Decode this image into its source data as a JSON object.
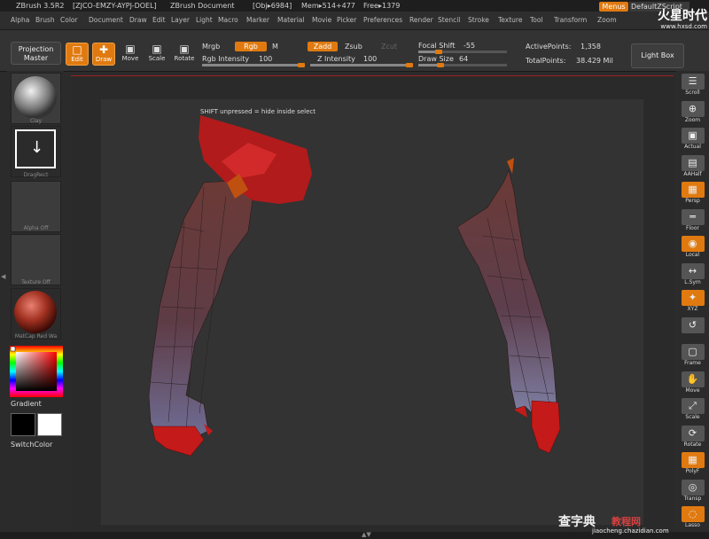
{
  "title_bar": {
    "app": "ZBrush 3.5R2",
    "license": "[ZJCO-EMZY-AYPJ-DOEL]",
    "document": "ZBrush Document",
    "obj": "[Obj▸6984]",
    "mem": "Mem▸514+477",
    "free": "Free▸1379"
  },
  "menu_bar": {
    "items": [
      "Alpha",
      "Brush",
      "Color",
      "Document",
      "Draw",
      "Edit",
      "Layer",
      "Light",
      "Macro",
      "Marker",
      "Material",
      "Movie",
      "Picker",
      "Preferences",
      "Render",
      "Stencil",
      "Stroke",
      "Texture",
      "Tool",
      "Transform",
      "Zoom"
    ],
    "menus_button": "Menus",
    "script": "DefaultZScript"
  },
  "watermark": {
    "top_logo": "火星时代",
    "top_url": "www.hxsd.com",
    "bottom_logo": "查字典",
    "bottom_tag": "教程网",
    "bottom_url": "jiaocheng.chazidian.com"
  },
  "toolbar": {
    "projection_master": "Projection Master",
    "edit": "Edit",
    "draw": "Draw",
    "move": "Move",
    "scale": "Scale",
    "rotate": "Rotate",
    "mrgb": "Mrgb",
    "rgb": "Rgb",
    "m": "M",
    "rgb_intensity_label": "Rgb Intensity",
    "rgb_intensity": "100",
    "rgb_intensity_level": 1.0,
    "zadd": "Zadd",
    "zsub": "Zsub",
    "zcut": "Zcut",
    "z_intensity_label": "Z Intensity",
    "z_intensity": "100",
    "z_intensity_level": 1.0,
    "focal_shift_label": "Focal Shift",
    "focal_shift": "-55",
    "focal_shift_level": 0.225,
    "draw_size_label": "Draw Size",
    "draw_size": "64",
    "draw_size_level": 0.25,
    "active_points_label": "ActivePoints:",
    "active_points": "1,358",
    "total_points_label": "TotalPoints:",
    "total_points": "38.429 Mil",
    "light_box": "Light Box"
  },
  "left_panel": {
    "material": "Clay",
    "stroke": "DragRect",
    "alpha": "Alpha  Off",
    "texture": "Texture  Off",
    "matcap": "MatCap Red Wa",
    "gradient": "Gradient",
    "switch_color": "SwitchColor"
  },
  "viewport": {
    "hint": "SHIFT unpressed = hide inside select"
  },
  "right_panel": {
    "buttons": [
      {
        "label": "Scroll",
        "icon": "☰",
        "on": false
      },
      {
        "label": "Zoom",
        "icon": "⊕",
        "on": false
      },
      {
        "label": "Actual",
        "icon": "▣",
        "on": false
      },
      {
        "label": "AAHalf",
        "icon": "▤",
        "on": false
      },
      {
        "label": "Persp",
        "icon": "▦",
        "on": true
      },
      {
        "label": "Floor",
        "icon": "═",
        "on": false
      },
      {
        "label": "Local",
        "icon": "◉",
        "on": true
      },
      {
        "label": "L.Sym",
        "icon": "↔",
        "on": false
      },
      {
        "label": "XYZ",
        "icon": "✦",
        "on": true
      },
      {
        "label": "",
        "icon": "↺",
        "on": false
      },
      {
        "label": "Frame",
        "icon": "▢",
        "on": false
      },
      {
        "label": "Move",
        "icon": "✋",
        "on": false
      },
      {
        "label": "Scale",
        "icon": "⤢",
        "on": false
      },
      {
        "label": "Rotate",
        "icon": "⟳",
        "on": false
      },
      {
        "label": "PolyF",
        "icon": "▦",
        "on": true
      },
      {
        "label": "Transp",
        "icon": "◎",
        "on": false
      },
      {
        "label": "Lasso",
        "icon": "◌",
        "on": true
      }
    ]
  },
  "colors": {
    "accent": "#e07a10",
    "mesh": "#6a4040",
    "mask": "#c81818",
    "panel": "#2b2b2b"
  }
}
